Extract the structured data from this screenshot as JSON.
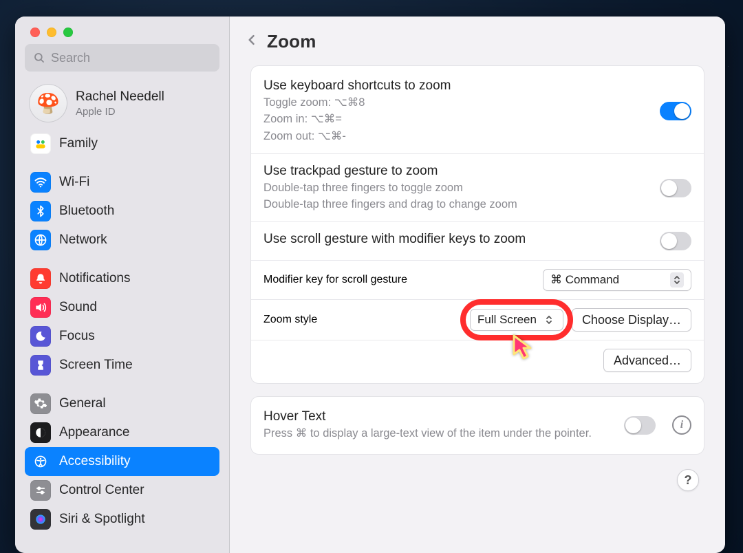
{
  "sidebar": {
    "search_placeholder": "Search",
    "account": {
      "name": "Rachel Needell",
      "sub": "Apple ID"
    },
    "family_label": "Family",
    "items": [
      {
        "id": "wifi",
        "label": "Wi-Fi"
      },
      {
        "id": "bluetooth",
        "label": "Bluetooth"
      },
      {
        "id": "network",
        "label": "Network"
      },
      {
        "id": "notifications",
        "label": "Notifications"
      },
      {
        "id": "sound",
        "label": "Sound"
      },
      {
        "id": "focus",
        "label": "Focus"
      },
      {
        "id": "screentime",
        "label": "Screen Time"
      },
      {
        "id": "general",
        "label": "General"
      },
      {
        "id": "appearance",
        "label": "Appearance"
      },
      {
        "id": "accessibility",
        "label": "Accessibility"
      },
      {
        "id": "controlcenter",
        "label": "Control Center"
      },
      {
        "id": "siri",
        "label": "Siri & Spotlight"
      }
    ]
  },
  "header": {
    "title": "Zoom"
  },
  "main": {
    "kb": {
      "label": "Use keyboard shortcuts to zoom",
      "desc1": "Toggle zoom: ⌥⌘8",
      "desc2": "Zoom in: ⌥⌘=",
      "desc3": "Zoom out: ⌥⌘-",
      "on": true
    },
    "trackpad": {
      "label": "Use trackpad gesture to zoom",
      "desc1": "Double-tap three fingers to toggle zoom",
      "desc2": "Double-tap three fingers and drag to change zoom",
      "on": false
    },
    "scroll": {
      "label": "Use scroll gesture with modifier keys to zoom",
      "on": false
    },
    "modifier": {
      "label": "Modifier key for scroll gesture",
      "value": "⌘ Command"
    },
    "style": {
      "label": "Zoom style",
      "value": "Full Screen",
      "choose_btn": "Choose Display…"
    },
    "advanced_btn": "Advanced…",
    "hover": {
      "label": "Hover Text",
      "desc": "Press ⌘ to display a large-text view of the item under the pointer.",
      "on": false
    },
    "help_glyph": "?"
  }
}
